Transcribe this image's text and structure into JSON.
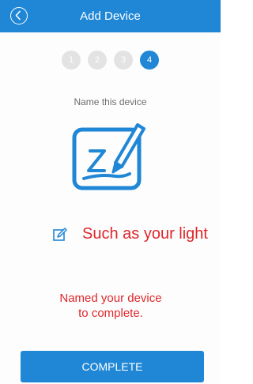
{
  "header": {
    "title": "Add Device",
    "back_icon": "chevron-left-icon"
  },
  "steps": {
    "items": [
      "1",
      "2",
      "3",
      "4"
    ],
    "current": 4
  },
  "main": {
    "subtitle": "Name this device",
    "illustration_icon": "signature-pen-icon",
    "edit_icon": "edit-pencil-icon",
    "example_text": "Such as your light",
    "hint_line1": "Named your device",
    "hint_line2": "to complete."
  },
  "footer": {
    "complete_label": "COMPLETE"
  },
  "colors": {
    "accent": "#1f87d6",
    "warning_text": "#e0262b",
    "inactive_step": "#e3e3e3"
  }
}
